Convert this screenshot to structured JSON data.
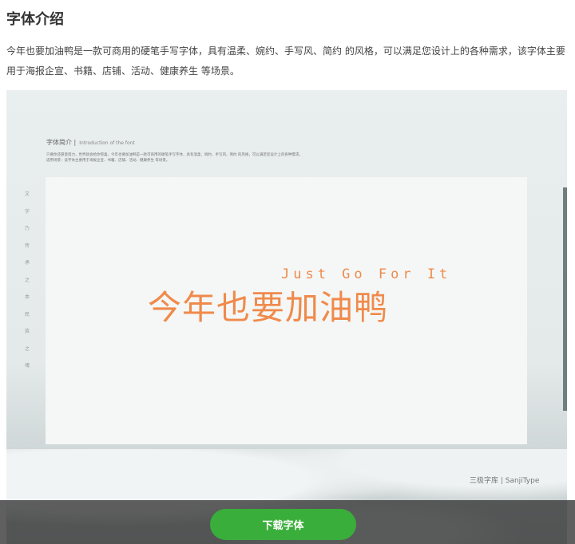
{
  "title": "字体介绍",
  "description": "今年也要加油鸭是一款可商用的硬笔手写字体，具有温柔、婉约、手写风、简约 的风格，可以满足您设计上的各种需求，该字体主要用于海报企宣、书籍、店铺、活动、健康养生 等场景。",
  "preview": {
    "heading": "字体简介 |",
    "heading_en": "Introduction of the font",
    "intro_line1": "只要你还愿意努力，世界就会给你惊喜。今年也要加油鸭是一款可商用的硬笔手写字体，具有温柔、婉约、手写风、简约 的风格，可以满足您设计上的各种需求。",
    "intro_line2": "适用场景：该字体主要用于海报企宣、书籍、店铺、活动、健康养生 等场景。",
    "vertical_chars": [
      "文",
      "字",
      "乃",
      "传",
      "承",
      "之",
      "本",
      "民",
      "族",
      "之",
      "魂"
    ],
    "slogan_en": "Just Go For It",
    "slogan_cn": "今年也要加油鸭",
    "brand": "三极字库 | SanjiType"
  },
  "download_label": "下载字体"
}
